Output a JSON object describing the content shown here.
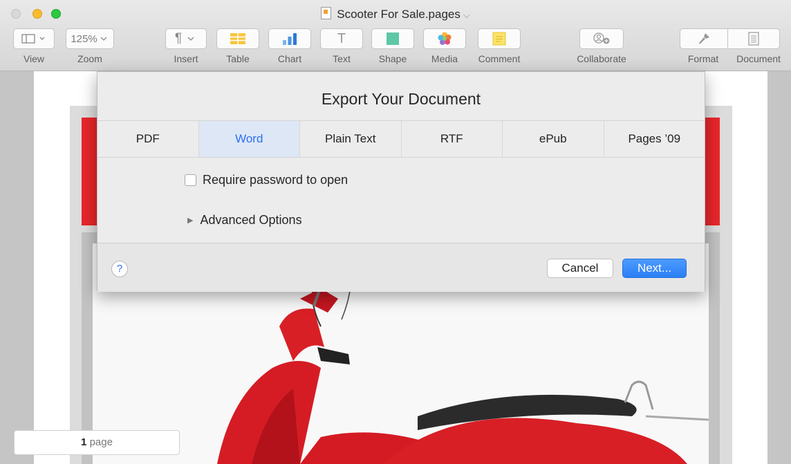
{
  "window": {
    "title": "Scooter For Sale.pages",
    "title_chevron": "⌵"
  },
  "toolbar": {
    "view": {
      "label": "View",
      "icon": "sidebar-icon"
    },
    "zoom": {
      "label": "Zoom",
      "value": "125%"
    },
    "insert": {
      "label": "Insert",
      "glyph": "¶"
    },
    "table": {
      "label": "Table"
    },
    "chart": {
      "label": "Chart"
    },
    "text": {
      "label": "Text",
      "glyph": "T"
    },
    "shape": {
      "label": "Shape"
    },
    "media": {
      "label": "Media"
    },
    "comment": {
      "label": "Comment"
    },
    "collaborate": {
      "label": "Collaborate"
    },
    "format": {
      "label": "Format"
    },
    "document": {
      "label": "Document"
    }
  },
  "dialog": {
    "title": "Export Your Document",
    "tabs": [
      "PDF",
      "Word",
      "Plain Text",
      "RTF",
      "ePub",
      "Pages ’09"
    ],
    "active_tab": "Word",
    "require_password_label": "Require password to open",
    "advanced_options_label": "Advanced Options",
    "help_label": "?",
    "cancel_label": "Cancel",
    "next_label": "Next..."
  },
  "status": {
    "page_count": "1",
    "page_word": "page"
  },
  "colors": {
    "accent": "#2b6ff0",
    "red_band": "#e8262b",
    "next_button": "#2b7ff5"
  }
}
